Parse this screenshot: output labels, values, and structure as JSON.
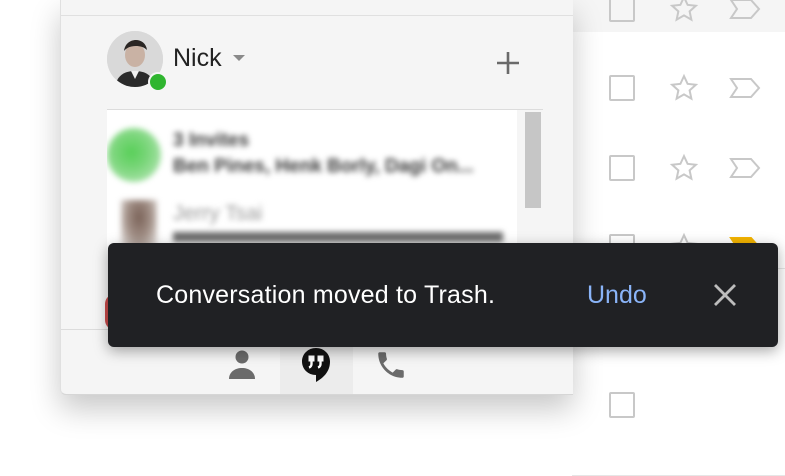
{
  "hangouts": {
    "user_name": "Nick",
    "new_conversation_icon": "plus-icon",
    "conversations": [
      {
        "title": "3 Invites",
        "subtitle": "Ben Pines, Henk Borly, Dagi On..."
      },
      {
        "title": "Jerry Tsai",
        "subtitle": ""
      }
    ],
    "tabs": [
      {
        "name": "people",
        "icon": "person-icon",
        "selected": false
      },
      {
        "name": "chat",
        "icon": "quote-bubble-icon",
        "selected": true
      },
      {
        "name": "phone",
        "icon": "phone-icon",
        "selected": false
      }
    ],
    "presence_color": "#2fb52f"
  },
  "snackbar": {
    "message": "Conversation moved to Trash.",
    "action_label": "Undo",
    "close_icon": "close-icon",
    "action_color": "#8ab4f8"
  },
  "email_list": {
    "rows": [
      {
        "checked": false,
        "starred": false,
        "label_color": ""
      },
      {
        "checked": false,
        "starred": false,
        "label_color": ""
      },
      {
        "checked": false,
        "starred": false,
        "label_color": ""
      },
      {
        "checked": false,
        "starred": false,
        "label_color": "#f4b400"
      },
      {
        "checked": false,
        "starred": false,
        "label_color": ""
      },
      {
        "checked": false,
        "starred": false,
        "label_color": ""
      }
    ]
  }
}
